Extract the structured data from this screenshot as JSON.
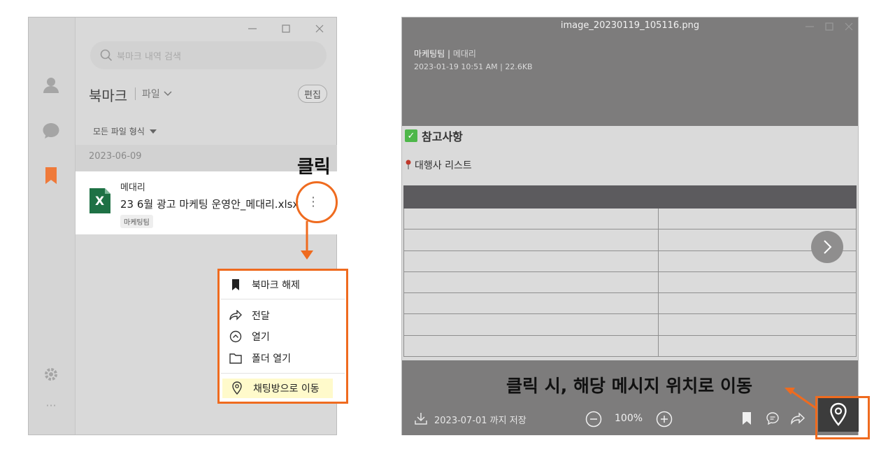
{
  "left_window": {
    "search_placeholder": "북마크 내역 검색",
    "title": "북마크",
    "filter_label": "파일",
    "edit_label": "편집",
    "type_filter_label": "모든 파일 형식",
    "date_group": "2023-06-09",
    "file_item": {
      "sender": "메대리",
      "filename": "23 6월 광고 마케팅 운영안_메대리.xlsx",
      "tag": "마케팅팀",
      "icon_letter": "X",
      "more_glyph": "⋮"
    },
    "sidebar_more": "···"
  },
  "context_menu": {
    "items": [
      {
        "label": "북마크 해제",
        "icon": "bookmark-icon"
      },
      {
        "label": "전달",
        "icon": "share-icon"
      },
      {
        "label": "열기",
        "icon": "open-icon"
      },
      {
        "label": "폴더 열기",
        "icon": "folder-icon"
      },
      {
        "label": "채팅방으로 이동",
        "icon": "location-pin-icon"
      }
    ]
  },
  "annotations": {
    "click_label": "클릭",
    "move_caption": "클릭 시, 해당 메시지 위치로 이동",
    "accent_color": "#ef6b1f"
  },
  "viewer": {
    "title": "image_20230119_105116.png",
    "sender": "마케팅팀",
    "sender_sep": " | ",
    "sender_sub": "메대리",
    "meta": "2023-01-19 10:51 AM | 22.6KB",
    "section_title": "참고사항",
    "check_glyph": "✓",
    "list_label": "대행사 리스트",
    "save_label": "2023-07-01 까지 저장",
    "zoom": "100%"
  },
  "colors": {
    "excel_green": "#1e7145",
    "check_green": "#4eb74a",
    "highlight_yellow": "#fffacb",
    "viewer_dark": "#7d7c7c"
  }
}
